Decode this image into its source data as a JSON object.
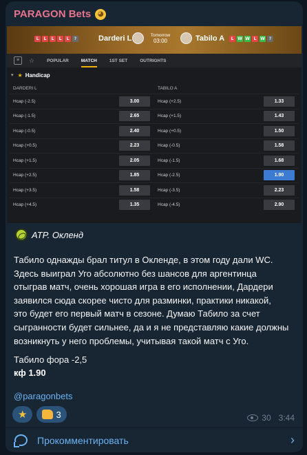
{
  "channel": {
    "name": "PARAGON Bets",
    "emoji_icon": "smiling-face-icon"
  },
  "screenshot": {
    "player1": {
      "name": "Darderi L",
      "form": [
        "L",
        "L",
        "L",
        "L",
        "L",
        "?"
      ]
    },
    "player2": {
      "name": "Tabilo A",
      "form": [
        "L",
        "W",
        "W",
        "L",
        "W",
        "?"
      ]
    },
    "kickoff": {
      "day": "Tomorrow",
      "time": "03:00"
    },
    "tabs": [
      "POPULAR",
      "MATCH",
      "1ST SET",
      "OUTRIGHTS"
    ],
    "active_tab": "MATCH",
    "market": "Handicap",
    "left_column": {
      "header": "DARDERI L",
      "rows": [
        {
          "label": "Hcap (-2.5)",
          "odd": "3.00"
        },
        {
          "label": "Hcap (-1.5)",
          "odd": "2.65"
        },
        {
          "label": "Hcap (-0.5)",
          "odd": "2.40"
        },
        {
          "label": "Hcap (+0.5)",
          "odd": "2.23"
        },
        {
          "label": "Hcap (+1.5)",
          "odd": "2.05"
        },
        {
          "label": "Hcap (+2.5)",
          "odd": "1.85"
        },
        {
          "label": "Hcap (+3.5)",
          "odd": "1.58"
        },
        {
          "label": "Hcap (+4.5)",
          "odd": "1.35"
        }
      ]
    },
    "right_column": {
      "header": "TABILO A",
      "rows": [
        {
          "label": "Hcap (+2.5)",
          "odd": "1.33"
        },
        {
          "label": "Hcap (+1.5)",
          "odd": "1.43"
        },
        {
          "label": "Hcap (+0.5)",
          "odd": "1.50"
        },
        {
          "label": "Hcap (-0.5)",
          "odd": "1.58"
        },
        {
          "label": "Hcap (-1.5)",
          "odd": "1.68"
        },
        {
          "label": "Hcap (-2.5)",
          "odd": "1.90",
          "selected": true
        },
        {
          "label": "Hcap (-3.5)",
          "odd": "2.23"
        },
        {
          "label": "Hcap (-4.5)",
          "odd": "2.90"
        }
      ]
    }
  },
  "post": {
    "tournament": "ATP. Окленд",
    "tournament_icon": "tennis-ball-icon",
    "body_lines": [
      "Табило однажды брал титул в Окленде, в этом году дали WC.",
      "Здесь выиграл Уго абсолютно без шансов для аргентинца",
      "отыграв матч, очень хорошая игра в его исполнении, Дардери",
      "заявился сюда скорее чисто для разминки, практики никакой,",
      "это будет его первый матч в сезоне. Думаю Табило за счет",
      "сыгранности будет сильнее, да и я не представляю какие должны",
      "возникнуть у него проблемы, учитывая такой матч с Уго."
    ],
    "bet": "Табило фора -2,5",
    "odds": "кф 1.90",
    "handle": "@paragonbets"
  },
  "reactions": [
    {
      "icon": "star-icon",
      "count": ""
    },
    {
      "icon": "thumbs-up-icon",
      "count": "3"
    }
  ],
  "views": "30",
  "time": "3:44",
  "comment_label": "Прокомментировать"
}
